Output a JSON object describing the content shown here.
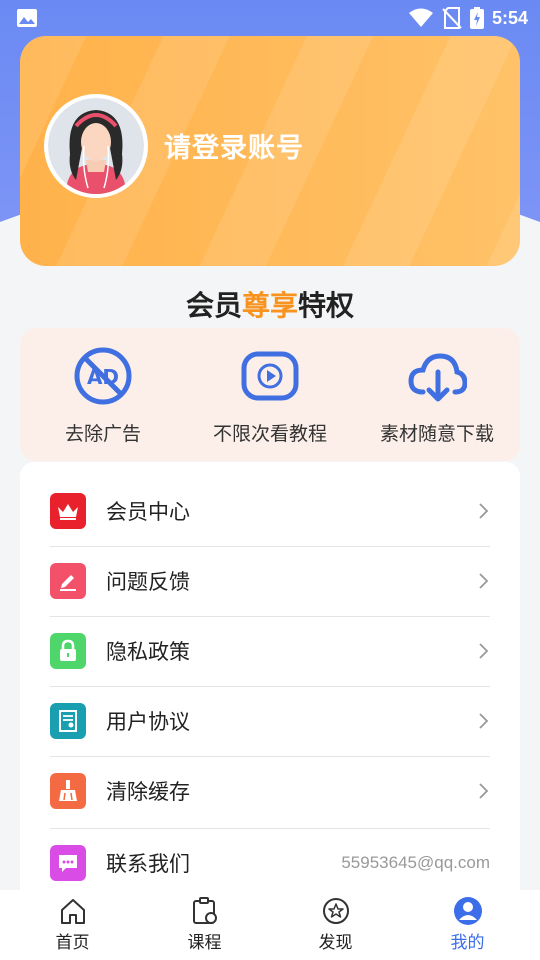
{
  "status_bar": {
    "time": "5:54"
  },
  "profile": {
    "login_prompt": "请登录账号"
  },
  "privileges": {
    "title_prefix": "会员",
    "title_highlight": "尊享",
    "title_suffix": "特权",
    "items": [
      {
        "label": "去除广告",
        "icon": "no-ads-icon"
      },
      {
        "label": "不限次看教程",
        "icon": "video-play-icon"
      },
      {
        "label": "素材随意下载",
        "icon": "cloud-download-icon"
      }
    ]
  },
  "menu": {
    "items": [
      {
        "label": "会员中心",
        "icon": "crown-icon",
        "color": "#e8212c"
      },
      {
        "label": "问题反馈",
        "icon": "edit-icon",
        "color": "#f3506a"
      },
      {
        "label": "隐私政策",
        "icon": "lock-icon",
        "color": "#4fd66b"
      },
      {
        "label": "用户协议",
        "icon": "document-icon",
        "color": "#1a9fb1"
      },
      {
        "label": "清除缓存",
        "icon": "broom-icon",
        "color": "#f46a43"
      },
      {
        "label": "联系我们",
        "icon": "chat-icon",
        "color": "#d94de6",
        "value": "55953645@qq.com"
      }
    ]
  },
  "tabbar": {
    "active_color": "#3d6ee9",
    "items": [
      {
        "label": "首页",
        "icon": "home-icon"
      },
      {
        "label": "课程",
        "icon": "course-icon"
      },
      {
        "label": "发现",
        "icon": "discover-icon"
      },
      {
        "label": "我的",
        "icon": "profile-icon",
        "active": true
      }
    ]
  }
}
